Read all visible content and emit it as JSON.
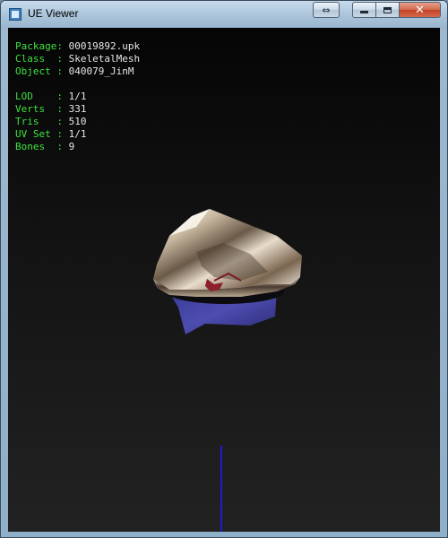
{
  "window": {
    "title": "UE Viewer",
    "buttons": {
      "swap": "⇔",
      "close": "✕"
    }
  },
  "info": {
    "package_label": "Package:",
    "package_value": "00019892.upk",
    "class_label": "Class  :",
    "class_value": "SkeletalMesh",
    "object_label": "Object :",
    "object_value": "040079_JinM",
    "lod_label": "LOD    :",
    "lod_value": "1/1",
    "verts_label": "Verts  :",
    "verts_value": "331",
    "tris_label": "Tris   :",
    "tris_value": "510",
    "uvset_label": "UV Set :",
    "uvset_value": "1/1",
    "bones_label": "Bones  :",
    "bones_value": "9"
  },
  "colors": {
    "label": "#3fe03f",
    "value": "#e6e6e6",
    "axis": "#1c1ccf"
  }
}
